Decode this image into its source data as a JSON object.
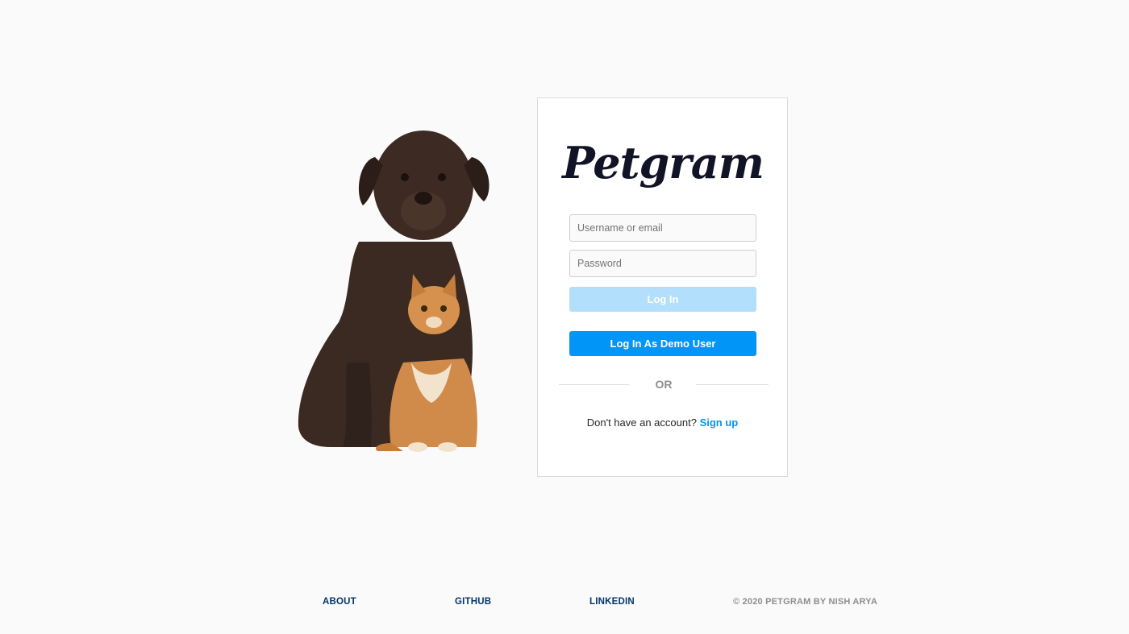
{
  "hero": {
    "image": "dog-and-cat-photo"
  },
  "login": {
    "logo": "Petgram",
    "username_placeholder": "Username or email",
    "password_placeholder": "Password",
    "login_label": "Log In",
    "demo_label": "Log In As Demo User",
    "divider_text": "OR",
    "signup_prompt": "Don't have an account?",
    "signup_link": "Sign up"
  },
  "footer": {
    "about": "ABOUT",
    "github": "GITHUB",
    "linkedin": "LINKEDIN",
    "copyright": "© 2020 PETGRAM BY NISH ARYA"
  },
  "colors": {
    "accent": "#0095f6",
    "accent_disabled": "#b2dffc",
    "background": "#fafafa",
    "logo": "#111326",
    "footer_link": "#00376b"
  }
}
